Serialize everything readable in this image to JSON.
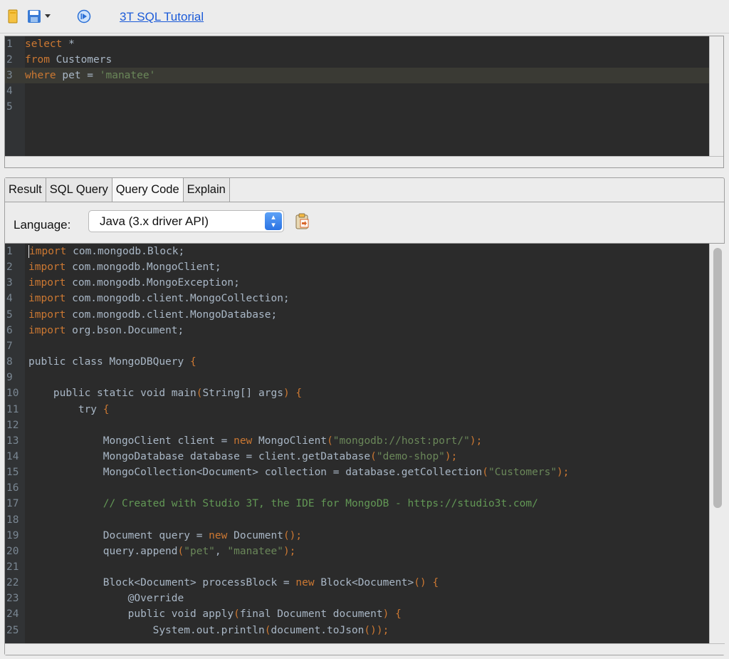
{
  "toolbar": {
    "tutorial_link": "3T SQL Tutorial",
    "icons": [
      "open-folder-icon",
      "save-icon",
      "dropdown-arrow-icon",
      "execute-icon"
    ]
  },
  "sql_editor": {
    "lines": [
      {
        "num": "1",
        "tokens": [
          {
            "t": "select",
            "c": "kw"
          },
          {
            "t": " *",
            "c": "txt"
          }
        ]
      },
      {
        "num": "2",
        "tokens": [
          {
            "t": "from",
            "c": "kw"
          },
          {
            "t": " Customers",
            "c": "txt"
          }
        ]
      },
      {
        "num": "3",
        "tokens": [
          {
            "t": "where",
            "c": "kw"
          },
          {
            "t": " pet = ",
            "c": "txt"
          },
          {
            "t": "'manatee'",
            "c": "str"
          }
        ],
        "highlight": true
      },
      {
        "num": "4",
        "tokens": []
      },
      {
        "num": "5",
        "tokens": []
      }
    ]
  },
  "tabs": [
    {
      "label": "Result",
      "active": false
    },
    {
      "label": "SQL Query",
      "active": false
    },
    {
      "label": "Query Code",
      "active": true
    },
    {
      "label": "Explain",
      "active": false
    }
  ],
  "language": {
    "label": "Language:",
    "selected": "Java (3.x driver API)"
  },
  "code_editor": {
    "lines": [
      {
        "num": "1",
        "tokens": [
          {
            "t": "import",
            "c": "kw"
          },
          {
            "t": " com.mongodb.Block;",
            "c": "txt"
          }
        ],
        "caret": true
      },
      {
        "num": "2",
        "tokens": [
          {
            "t": "import",
            "c": "kw"
          },
          {
            "t": " com.mongodb.MongoClient;",
            "c": "txt"
          }
        ]
      },
      {
        "num": "3",
        "tokens": [
          {
            "t": "import",
            "c": "kw"
          },
          {
            "t": " com.mongodb.MongoException;",
            "c": "txt"
          }
        ]
      },
      {
        "num": "4",
        "tokens": [
          {
            "t": "import",
            "c": "kw"
          },
          {
            "t": " com.mongodb.client.MongoCollection;",
            "c": "txt"
          }
        ]
      },
      {
        "num": "5",
        "tokens": [
          {
            "t": "import",
            "c": "kw"
          },
          {
            "t": " com.mongodb.client.MongoDatabase;",
            "c": "txt"
          }
        ]
      },
      {
        "num": "6",
        "tokens": [
          {
            "t": "import",
            "c": "kw"
          },
          {
            "t": " org.bson.Document;",
            "c": "txt"
          }
        ]
      },
      {
        "num": "7",
        "tokens": []
      },
      {
        "num": "8",
        "tokens": [
          {
            "t": "public class MongoDBQuery ",
            "c": "txt"
          },
          {
            "t": "{",
            "c": "kw"
          }
        ]
      },
      {
        "num": "9",
        "tokens": []
      },
      {
        "num": "10",
        "tokens": [
          {
            "t": "    public static void main",
            "c": "txt"
          },
          {
            "t": "(",
            "c": "kw"
          },
          {
            "t": "String[] args",
            "c": "txt"
          },
          {
            "t": ") {",
            "c": "kw"
          }
        ]
      },
      {
        "num": "11",
        "tokens": [
          {
            "t": "        try ",
            "c": "txt"
          },
          {
            "t": "{",
            "c": "kw"
          }
        ]
      },
      {
        "num": "12",
        "tokens": []
      },
      {
        "num": "13",
        "tokens": [
          {
            "t": "            MongoClient client = ",
            "c": "txt"
          },
          {
            "t": "new",
            "c": "kw"
          },
          {
            "t": " MongoClient",
            "c": "txt"
          },
          {
            "t": "(",
            "c": "kw"
          },
          {
            "t": "\"mongodb://host:port/\"",
            "c": "str"
          },
          {
            "t": ");",
            "c": "kw"
          }
        ]
      },
      {
        "num": "14",
        "tokens": [
          {
            "t": "            MongoDatabase database = client.getDatabase",
            "c": "txt"
          },
          {
            "t": "(",
            "c": "kw"
          },
          {
            "t": "\"demo-shop\"",
            "c": "str"
          },
          {
            "t": ");",
            "c": "kw"
          }
        ]
      },
      {
        "num": "15",
        "tokens": [
          {
            "t": "            MongoCollection<Document> collection = database.getCollection",
            "c": "txt"
          },
          {
            "t": "(",
            "c": "kw"
          },
          {
            "t": "\"Customers\"",
            "c": "str"
          },
          {
            "t": ");",
            "c": "kw"
          }
        ]
      },
      {
        "num": "16",
        "tokens": []
      },
      {
        "num": "17",
        "tokens": [
          {
            "t": "            // Created with Studio 3T, the IDE for MongoDB - https://studio3t.com/",
            "c": "cmt"
          }
        ]
      },
      {
        "num": "18",
        "tokens": []
      },
      {
        "num": "19",
        "tokens": [
          {
            "t": "            Document query = ",
            "c": "txt"
          },
          {
            "t": "new",
            "c": "kw"
          },
          {
            "t": " Document",
            "c": "txt"
          },
          {
            "t": "();",
            "c": "kw"
          }
        ]
      },
      {
        "num": "20",
        "tokens": [
          {
            "t": "            query.append",
            "c": "txt"
          },
          {
            "t": "(",
            "c": "kw"
          },
          {
            "t": "\"pet\"",
            "c": "str"
          },
          {
            "t": ", ",
            "c": "txt"
          },
          {
            "t": "\"manatee\"",
            "c": "str"
          },
          {
            "t": ");",
            "c": "kw"
          }
        ]
      },
      {
        "num": "21",
        "tokens": []
      },
      {
        "num": "22",
        "tokens": [
          {
            "t": "            Block<Document> processBlock = ",
            "c": "txt"
          },
          {
            "t": "new",
            "c": "kw"
          },
          {
            "t": " Block<Document>",
            "c": "txt"
          },
          {
            "t": "() {",
            "c": "kw"
          }
        ]
      },
      {
        "num": "23",
        "tokens": [
          {
            "t": "                @Override",
            "c": "txt"
          }
        ]
      },
      {
        "num": "24",
        "tokens": [
          {
            "t": "                public void apply",
            "c": "txt"
          },
          {
            "t": "(",
            "c": "kw"
          },
          {
            "t": "final Document document",
            "c": "txt"
          },
          {
            "t": ") {",
            "c": "kw"
          }
        ]
      },
      {
        "num": "25",
        "tokens": [
          {
            "t": "                    System.out.println",
            "c": "txt"
          },
          {
            "t": "(",
            "c": "kw"
          },
          {
            "t": "document.toJson",
            "c": "txt"
          },
          {
            "t": "());",
            "c": "kw"
          }
        ]
      }
    ]
  }
}
